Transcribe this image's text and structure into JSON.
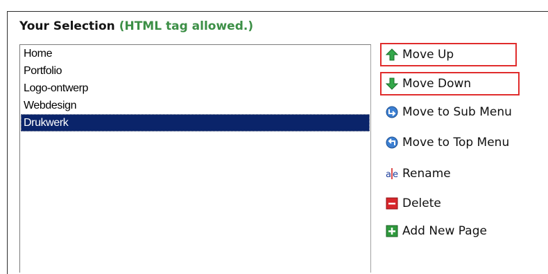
{
  "heading": {
    "title": "Your Selection",
    "note": "(HTML tag allowed.)"
  },
  "list": {
    "items": [
      "Home",
      "Portfolio",
      "Logo-ontwerp",
      "Webdesign",
      "Drukwerk"
    ],
    "selected": "Drukwerk"
  },
  "actions": {
    "move_up": "Move Up",
    "move_down": "Move Down",
    "move_sub": "Move to Sub Menu",
    "move_top": "Move to Top Menu",
    "rename": "Rename",
    "delete": "Delete",
    "add_page": "Add New Page"
  },
  "colors": {
    "highlight_box": "#e02b2b",
    "selection": "#0a246a",
    "note_green": "#3c8f46"
  },
  "icons": {
    "move_up": "green-up-arrow-icon",
    "move_down": "green-down-arrow-icon",
    "move_sub": "move-to-submenu-icon",
    "move_top": "move-to-topmenu-icon",
    "rename": "rename-icon",
    "delete": "delete-icon",
    "add_page": "add-page-icon"
  }
}
